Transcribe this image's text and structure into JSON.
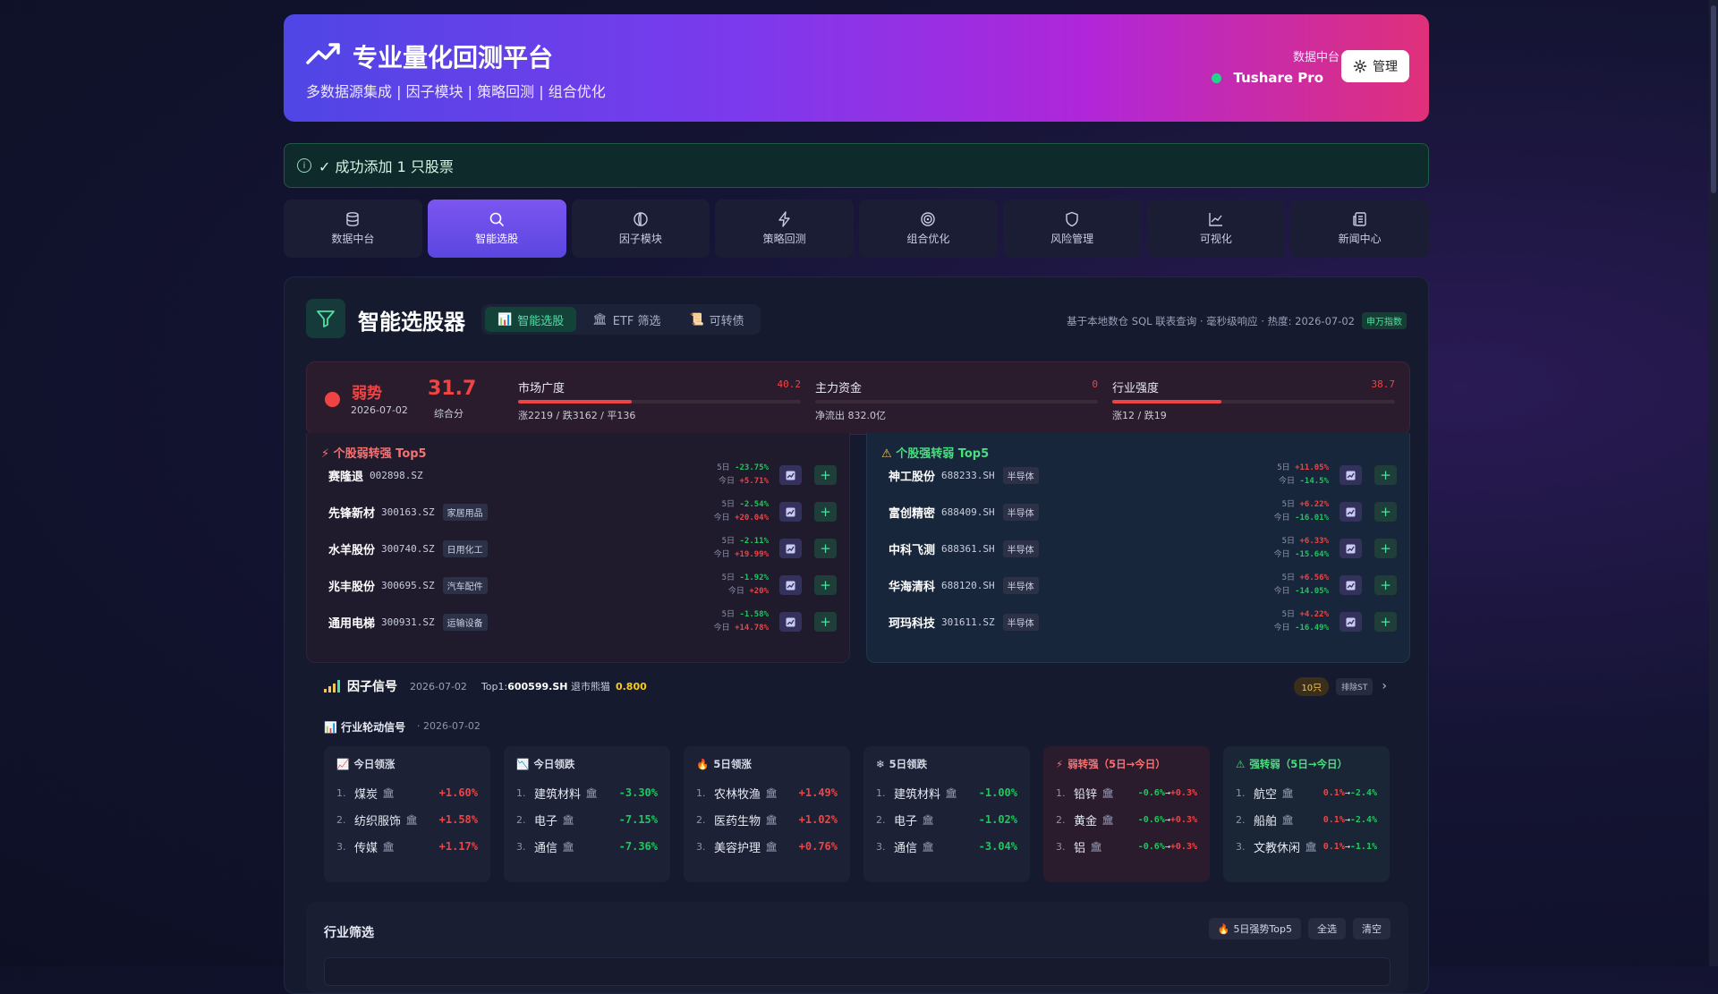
{
  "header": {
    "title": "专业量化回测平台",
    "subtitle": "多数据源集成 | 因子模块 | 策略回测 | 组合优化",
    "source_label": "数据中台",
    "source_name": "Tushare Pro",
    "manage_label": "管理"
  },
  "alert": {
    "message": "✓ 成功添加 1 只股票"
  },
  "nav": {
    "tabs": [
      {
        "label": "数据中台",
        "icon": "database-icon"
      },
      {
        "label": "智能选股",
        "icon": "search-icon",
        "active": true
      },
      {
        "label": "因子模块",
        "icon": "factor-icon"
      },
      {
        "label": "策略回测",
        "icon": "lightning-icon"
      },
      {
        "label": "组合优化",
        "icon": "target-icon"
      },
      {
        "label": "风险管理",
        "icon": "shield-icon"
      },
      {
        "label": "可视化",
        "icon": "line-chart-icon"
      },
      {
        "label": "新闻中心",
        "icon": "news-icon"
      }
    ]
  },
  "panel": {
    "title": "智能选股器",
    "sub_tabs": [
      {
        "label": "智能选股",
        "icon": "📊",
        "active": true
      },
      {
        "label": "ETF 筛选",
        "icon": "🏛"
      },
      {
        "label": "可转债",
        "icon": "📜"
      }
    ],
    "meta": "基于本地数仓 SQL 联表查询 · 毫秒级响应 · 热度: 2026-07-02",
    "meta_badge": "申万指数"
  },
  "market": {
    "state": "弱势",
    "date": "2026-07-02",
    "score": "31.7",
    "score_label": "综合分",
    "metrics": [
      {
        "name": "市场广度",
        "value": "40.2",
        "level": 40.2,
        "desc": "涨2219 / 跌3162 / 平136"
      },
      {
        "name": "主力资金",
        "value": "0",
        "level": 0,
        "desc": "净流出 832.0亿"
      },
      {
        "name": "行业强度",
        "value": "38.7",
        "level": 38.7,
        "desc": "涨12 / 跌19"
      }
    ]
  },
  "weak_to_strong": {
    "title": "个股弱转强 Top5",
    "stocks": [
      {
        "name": "赛隆退",
        "code": "002898.SZ",
        "tag": "",
        "d5_label": "5日",
        "d5": "-23.75%",
        "today_label": "今日",
        "today": "+5.71%"
      },
      {
        "name": "先锋新材",
        "code": "300163.SZ",
        "tag": "家居用品",
        "d5_label": "5日",
        "d5": "-2.54%",
        "today_label": "今日",
        "today": "+20.04%"
      },
      {
        "name": "水羊股份",
        "code": "300740.SZ",
        "tag": "日用化工",
        "d5_label": "5日",
        "d5": "-2.11%",
        "today_label": "今日",
        "today": "+19.99%"
      },
      {
        "name": "兆丰股份",
        "code": "300695.SZ",
        "tag": "汽车配件",
        "d5_label": "5日",
        "d5": "-1.92%",
        "today_label": "今日",
        "today": "+20%"
      },
      {
        "name": "通用电梯",
        "code": "300931.SZ",
        "tag": "运输设备",
        "d5_label": "5日",
        "d5": "-1.58%",
        "today_label": "今日",
        "today": "+14.78%"
      }
    ]
  },
  "strong_to_weak": {
    "title": "个股强转弱 Top5",
    "stocks": [
      {
        "name": "神工股份",
        "code": "688233.SH",
        "tag": "半导体",
        "d5_label": "5日",
        "d5": "+11.05%",
        "today_label": "今日",
        "today": "-14.5%"
      },
      {
        "name": "富创精密",
        "code": "688409.SH",
        "tag": "半导体",
        "d5_label": "5日",
        "d5": "+6.22%",
        "today_label": "今日",
        "today": "-16.01%"
      },
      {
        "name": "中科飞测",
        "code": "688361.SH",
        "tag": "半导体",
        "d5_label": "5日",
        "d5": "+6.33%",
        "today_label": "今日",
        "today": "-15.64%"
      },
      {
        "name": "华海清科",
        "code": "688120.SH",
        "tag": "半导体",
        "d5_label": "5日",
        "d5": "+6.56%",
        "today_label": "今日",
        "today": "-14.05%"
      },
      {
        "name": "珂玛科技",
        "code": "301611.SZ",
        "tag": "半导体",
        "d5_label": "5日",
        "d5": "+4.22%",
        "today_label": "今日",
        "today": "-16.49%"
      }
    ]
  },
  "factor_signal": {
    "title": "因子信号",
    "date": "2026-07-02",
    "top_label": "Top1:",
    "top_code": "600599.SH",
    "top_name": "退市熊猫",
    "top_score": "0.800",
    "count": "10只",
    "exclude_label": "排除ST"
  },
  "rotation": {
    "title": "行业轮动信号",
    "date": "· 2026-07-02",
    "cards": [
      {
        "title": "今日领涨",
        "icon": "📈",
        "items": [
          {
            "rank": "1.",
            "label": "煤炭",
            "value": "+1.60%"
          },
          {
            "rank": "2.",
            "label": "纺织服饰",
            "value": "+1.58%"
          },
          {
            "rank": "3.",
            "label": "传媒",
            "value": "+1.17%"
          }
        ]
      },
      {
        "title": "今日领跌",
        "icon": "📉",
        "items": [
          {
            "rank": "1.",
            "label": "建筑材料",
            "value": "-3.30%"
          },
          {
            "rank": "2.",
            "label": "电子",
            "value": "-7.15%"
          },
          {
            "rank": "3.",
            "label": "通信",
            "value": "-7.36%"
          }
        ]
      },
      {
        "title": "5日领涨",
        "icon": "🔥",
        "items": [
          {
            "rank": "1.",
            "label": "农林牧渔",
            "value": "+1.49%"
          },
          {
            "rank": "2.",
            "label": "医药生物",
            "value": "+1.02%"
          },
          {
            "rank": "3.",
            "label": "美容护理",
            "value": "+0.76%"
          }
        ]
      },
      {
        "title": "5日领跌",
        "icon": "❄",
        "items": [
          {
            "rank": "1.",
            "label": "建筑材料",
            "value": "-1.00%"
          },
          {
            "rank": "2.",
            "label": "电子",
            "value": "-1.02%"
          },
          {
            "rank": "3.",
            "label": "通信",
            "value": "-3.04%"
          }
        ]
      },
      {
        "title": "弱转强（5日→今日）",
        "icon": "⚡",
        "items": [
          {
            "rank": "1.",
            "label": "铅锌",
            "v1": "-0.6%",
            "arrow": "→",
            "v2": "+0.3%"
          },
          {
            "rank": "2.",
            "label": "黄金",
            "v1": "-0.6%",
            "arrow": "→",
            "v2": "+0.3%"
          },
          {
            "rank": "3.",
            "label": "铝",
            "v1": "-0.6%",
            "arrow": "→",
            "v2": "+0.3%"
          }
        ]
      },
      {
        "title": "强转弱（5日→今日）",
        "icon": "⚠",
        "items": [
          {
            "rank": "1.",
            "label": "航空",
            "v1": "0.1%",
            "arrow": "→",
            "v2": "-2.4%"
          },
          {
            "rank": "2.",
            "label": "船舶",
            "v1": "0.1%",
            "arrow": "→",
            "v2": "-2.4%"
          },
          {
            "rank": "3.",
            "label": "文教休闲",
            "v1": "0.1%",
            "arrow": "→",
            "v2": "-1.1%"
          }
        ]
      }
    ]
  },
  "industry_filter": {
    "title": "行业筛选",
    "buttons": [
      {
        "label": "5日强势Top5",
        "icon": "🔥"
      },
      {
        "label": "全选"
      },
      {
        "label": "清空"
      }
    ]
  },
  "colors": {
    "up": "#ef4444",
    "down": "#22c55e",
    "accent": "#7c55f0",
    "brand_green": "#4de0a3"
  }
}
